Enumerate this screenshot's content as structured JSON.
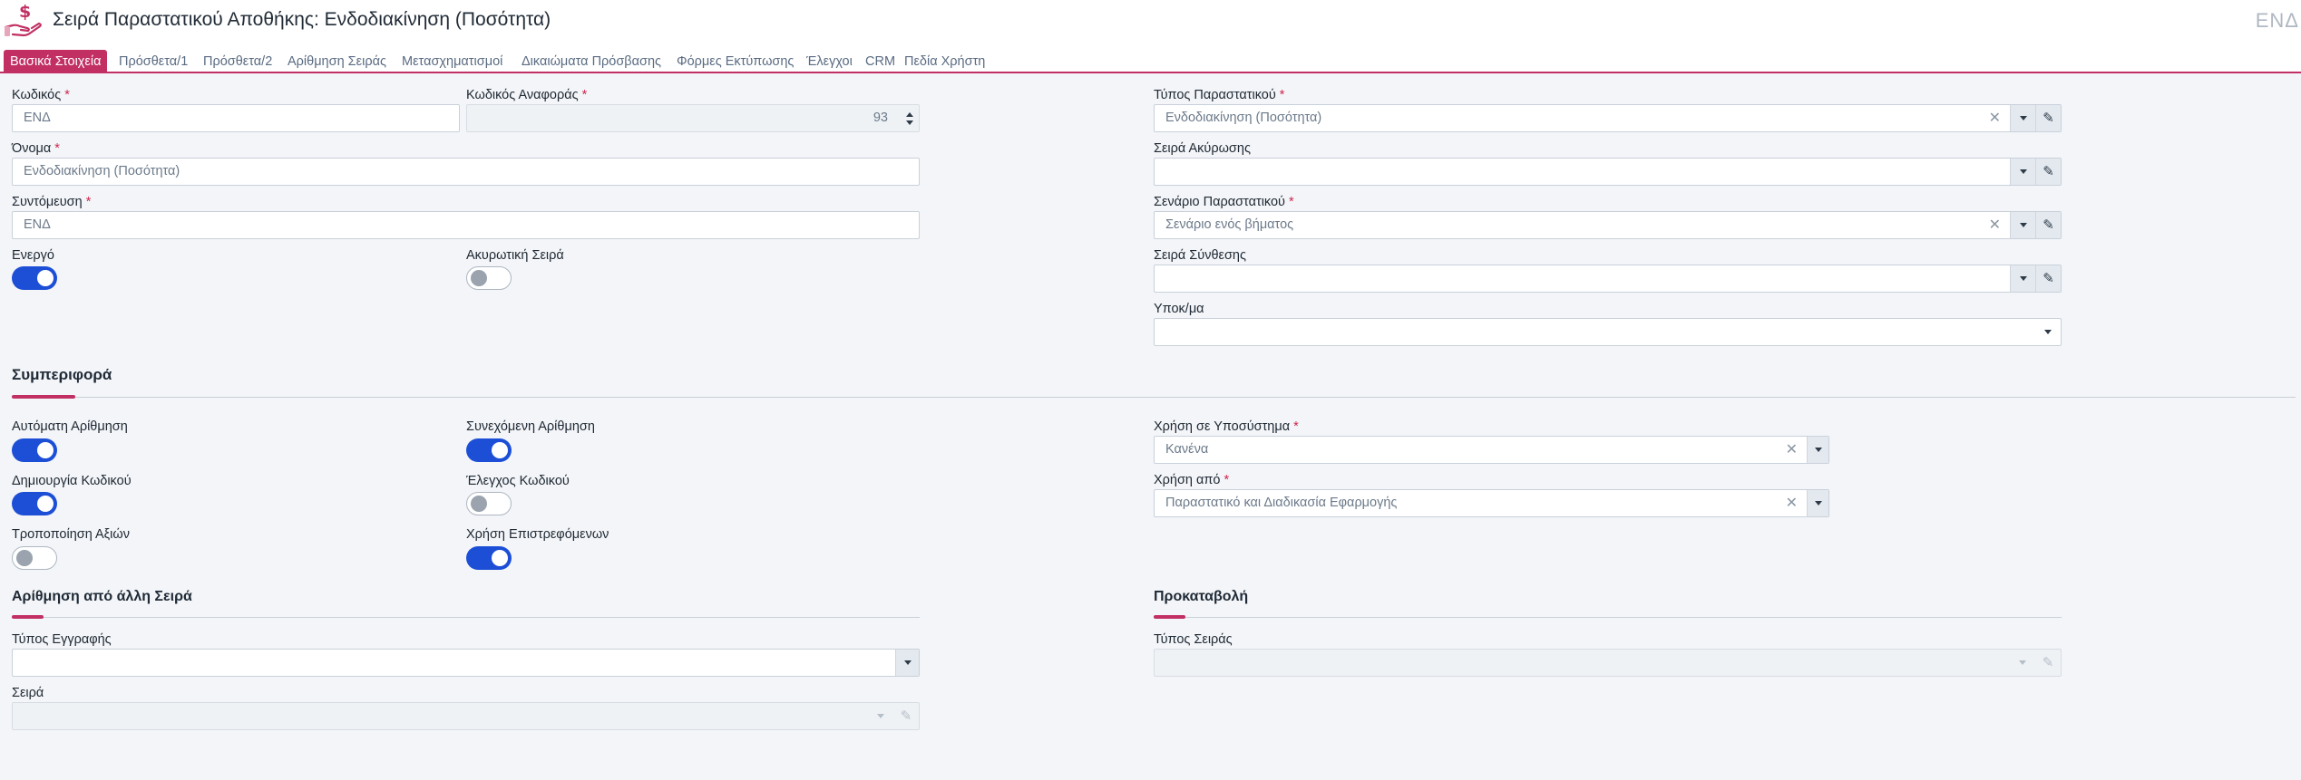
{
  "header": {
    "title": "Σειρά Παραστατικού Αποθήκης: Ενδοδιακίνηση (Ποσότητα)",
    "right_code": "ΕΝΔ",
    "icon": "money-hand-icon"
  },
  "tabs": [
    {
      "label": "Βασικά Στοιχεία",
      "active": true
    },
    {
      "label": "Πρόσθετα/1"
    },
    {
      "label": "Πρόσθετα/2"
    },
    {
      "label": "Αρίθμηση Σειράς"
    },
    {
      "label": "Μετασχηματισμοί"
    },
    {
      "label": "Δικαιώματα Πρόσβασης"
    },
    {
      "label": "Φόρμες Εκτύπωσης"
    },
    {
      "label": "Έλεγχοι"
    },
    {
      "label": "CRM"
    },
    {
      "label": "Πεδία Χρήστη"
    }
  ],
  "basic": {
    "code": {
      "label": "Κωδικός",
      "value": "ΕΝΔ"
    },
    "ref_code": {
      "label": "Κωδικός Αναφοράς",
      "value": "93"
    },
    "name": {
      "label": "Όνομα",
      "value": "Ενδοδιακίνηση (Ποσότητα)"
    },
    "short": {
      "label": "Συντόμευση",
      "value": "ΕΝΔ"
    },
    "active": {
      "label": "Ενεργό",
      "on": true
    },
    "cancel_series": {
      "label": "Ακυρωτική Σειρά",
      "on": false
    },
    "doc_type": {
      "label": "Τύπος Παραστατικού",
      "value": "Ενδοδιακίνηση (Ποσότητα)"
    },
    "cancel_series_ref": {
      "label": "Σειρά Ακύρωσης",
      "value": ""
    },
    "scenario": {
      "label": "Σενάριο Παραστατικού",
      "value": "Σενάριο ενός βήματος"
    },
    "composition_series": {
      "label": "Σειρά Σύνθεσης",
      "value": ""
    },
    "branch": {
      "label": "Υποκ/μα",
      "value": ""
    }
  },
  "behavior": {
    "title": "Συμπεριφορά",
    "auto_numbering": {
      "label": "Αυτόματη Αρίθμηση",
      "on": true
    },
    "continuous_numbering": {
      "label": "Συνεχόμενη Αρίθμηση",
      "on": true
    },
    "code_creation": {
      "label": "Δημιουργία Κωδικού",
      "on": true
    },
    "code_check": {
      "label": "Έλεγχος Κωδικού",
      "on": false
    },
    "value_modification": {
      "label": "Τροποποίηση Αξιών",
      "on": false
    },
    "use_returned": {
      "label": "Χρήση Επιστρεφόμενων",
      "on": true
    },
    "subsystem_use": {
      "label": "Χρήση σε Υποσύστημα",
      "value": "Κανένα"
    },
    "used_by": {
      "label": "Χρήση από",
      "value": "Παραστατικό και Διαδικασία Εφαρμογής"
    }
  },
  "other_numbering": {
    "title": "Αρίθμηση από άλλη Σειρά",
    "record_type": {
      "label": "Τύπος Εγγραφής",
      "value": ""
    },
    "series": {
      "label": "Σειρά",
      "value": ""
    }
  },
  "prepayment": {
    "title": "Προκαταβολή",
    "series_type": {
      "label": "Τύπος Σειράς",
      "value": ""
    }
  },
  "colors": {
    "accent": "#c12f63",
    "toggle_on": "#1c4fd6",
    "required": "#d0264f"
  }
}
